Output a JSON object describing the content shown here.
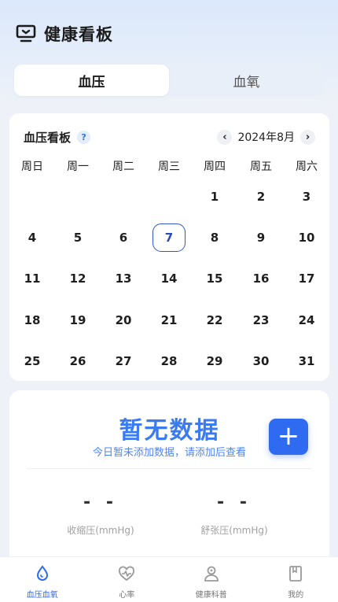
{
  "header": {
    "title": "健康看板"
  },
  "tabs": [
    {
      "label": "血压",
      "active": true
    },
    {
      "label": "血氧",
      "active": false
    }
  ],
  "calendar": {
    "title": "血压看板",
    "help": "?",
    "prev": "‹",
    "next": "›",
    "month_label": "2024年8月",
    "weekdays": [
      "周日",
      "周一",
      "周二",
      "周三",
      "周四",
      "周五",
      "周六"
    ],
    "first_weekday": 4,
    "days_in_month": 31,
    "today": 7
  },
  "summary": {
    "nodata_title": "暂无数据",
    "nodata_subtitle": "今日暂未添加数据，请添加后查看",
    "add_label": "+",
    "systolic_value": "- -",
    "systolic_label": "收缩压(mmHg)",
    "diastolic_value": "- -",
    "diastolic_label": "舒张压(mmHg)"
  },
  "bottom_nav": [
    {
      "label": "血压血氧",
      "icon": "blood-drop-icon",
      "active": true
    },
    {
      "label": "心率",
      "icon": "heart-rate-icon",
      "active": false
    },
    {
      "label": "健康科普",
      "icon": "doctor-icon",
      "active": false
    },
    {
      "label": "我的",
      "icon": "book-icon",
      "active": false
    }
  ],
  "colors": {
    "accent": "#2f6bf0",
    "today_border": "#3256c7",
    "background": "#eef2f8"
  }
}
